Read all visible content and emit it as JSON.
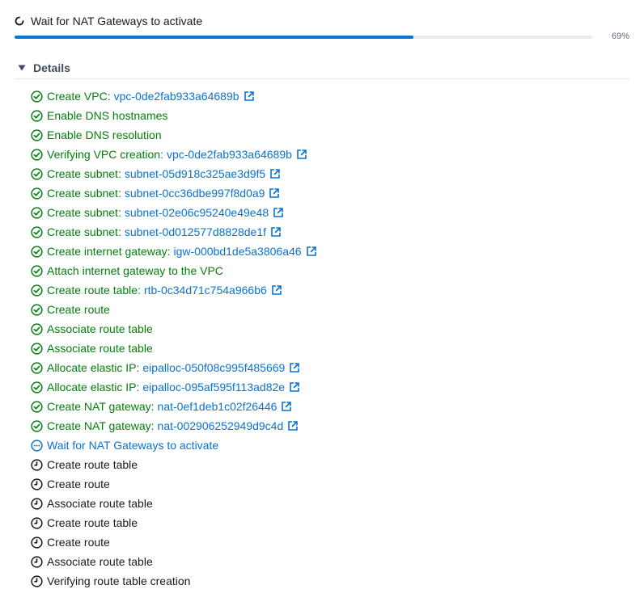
{
  "header": {
    "title": "Wait for NAT Gateways to activate",
    "progress_percent": 69,
    "progress_label": "69%",
    "icon": "spinner-icon"
  },
  "details": {
    "label": "Details",
    "expanded": true
  },
  "colors": {
    "success": "#037f0c",
    "in_progress": "#0972d3",
    "pending": "#16191f",
    "link": "#0972d3",
    "progress_fill": "#0972d3",
    "progress_track": "#e9ebed"
  },
  "steps": [
    {
      "status": "success",
      "label": "Create VPC:",
      "link": "vpc-0de2fab933a64689b"
    },
    {
      "status": "success",
      "label": "Enable DNS hostnames",
      "link": ""
    },
    {
      "status": "success",
      "label": "Enable DNS resolution",
      "link": ""
    },
    {
      "status": "success",
      "label": "Verifying VPC creation:",
      "link": "vpc-0de2fab933a64689b"
    },
    {
      "status": "success",
      "label": "Create subnet:",
      "link": "subnet-05d918c325ae3d9f5"
    },
    {
      "status": "success",
      "label": "Create subnet:",
      "link": "subnet-0cc36dbe997f8d0a9"
    },
    {
      "status": "success",
      "label": "Create subnet:",
      "link": "subnet-02e06c95240e49e48"
    },
    {
      "status": "success",
      "label": "Create subnet:",
      "link": "subnet-0d012577d8828de1f"
    },
    {
      "status": "success",
      "label": "Create internet gateway:",
      "link": "igw-000bd1de5a3806a46"
    },
    {
      "status": "success",
      "label": "Attach internet gateway to the VPC",
      "link": ""
    },
    {
      "status": "success",
      "label": "Create route table:",
      "link": "rtb-0c34d71c754a966b6"
    },
    {
      "status": "success",
      "label": "Create route",
      "link": ""
    },
    {
      "status": "success",
      "label": "Associate route table",
      "link": ""
    },
    {
      "status": "success",
      "label": "Associate route table",
      "link": ""
    },
    {
      "status": "success",
      "label": "Allocate elastic IP:",
      "link": "eipalloc-050f08c995f485669"
    },
    {
      "status": "success",
      "label": "Allocate elastic IP:",
      "link": "eipalloc-095af595f113ad82e"
    },
    {
      "status": "success",
      "label": "Create NAT gateway:",
      "link": "nat-0ef1deb1c02f26446"
    },
    {
      "status": "success",
      "label": "Create NAT gateway:",
      "link": "nat-002906252949d9c4d"
    },
    {
      "status": "in-progress",
      "label": "Wait for NAT Gateways to activate",
      "link": ""
    },
    {
      "status": "pending",
      "label": "Create route table",
      "link": ""
    },
    {
      "status": "pending",
      "label": "Create route",
      "link": ""
    },
    {
      "status": "pending",
      "label": "Associate route table",
      "link": ""
    },
    {
      "status": "pending",
      "label": "Create route table",
      "link": ""
    },
    {
      "status": "pending",
      "label": "Create route",
      "link": ""
    },
    {
      "status": "pending",
      "label": "Associate route table",
      "link": ""
    },
    {
      "status": "pending",
      "label": "Verifying route table creation",
      "link": ""
    }
  ]
}
